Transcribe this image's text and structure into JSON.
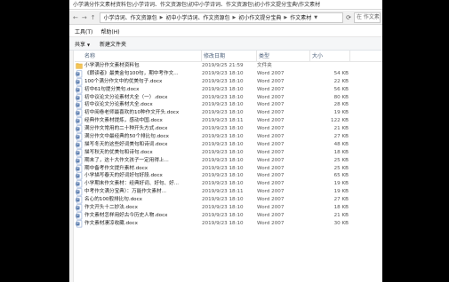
{
  "window": {
    "title": "小学满分作文素材资料包\\小学诗词、作文资源包\\初中小学诗词、作文资源包\\初小作文提分宝典\\作文素材"
  },
  "address": {
    "crumbs": [
      "小学诗词、作文资源包",
      "初中小学诗词、作文资源包",
      "初小作文提分宝典",
      "作文素材"
    ],
    "search_placeholder": "在 作文素材"
  },
  "menu": {
    "items": [
      "工具(T)",
      "帮助(H)"
    ]
  },
  "toolbar": {
    "share_label": "共享",
    "new_folder_label": "新建文件夹"
  },
  "columns": {
    "name": "名称",
    "date": "修改日期",
    "type": "类型",
    "size": "大小"
  },
  "files": [
    {
      "name": "小学满分作文素材资料包",
      "date": "2019/9/25 21:59",
      "type": "文件夹",
      "size": "",
      "kind": "folder"
    },
    {
      "name": "《朗读者》最美金句100句，期中考作文...",
      "date": "2019/9/23 18:10",
      "type": "Word 2007",
      "size": "54 KB",
      "kind": "doc"
    },
    {
      "name": "100个满分作文中的优美句子.docx",
      "date": "2019/9/23 18:10",
      "type": "Word 2007",
      "size": "22 KB",
      "kind": "doc"
    },
    {
      "name": "初中61句提分美句.docx",
      "date": "2019/9/23 18:10",
      "type": "Word 2007",
      "size": "56 KB",
      "kind": "doc"
    },
    {
      "name": "初中议论文分论素材大全（一）.docx",
      "date": "2019/9/23 18:10",
      "type": "Word 2007",
      "size": "80 KB",
      "kind": "doc"
    },
    {
      "name": "初中议论文分论素材大全.docx",
      "date": "2019/9/23 18:10",
      "type": "Word 2007",
      "size": "28 KB",
      "kind": "doc"
    },
    {
      "name": "初中阅卷老师最喜欢的10种作文开头.docx",
      "date": "2019/9/23 18:10",
      "type": "Word 2007",
      "size": "19 KB",
      "kind": "doc"
    },
    {
      "name": "经典作文素材提炼，感动中国.docx",
      "date": "2019/9/23 18:11",
      "type": "Word 2007",
      "size": "122 KB",
      "kind": "doc"
    },
    {
      "name": "满分作文常用的二十种开头方式.docx",
      "date": "2019/9/23 18:10",
      "type": "Word 2007",
      "size": "21 KB",
      "kind": "doc"
    },
    {
      "name": "满分作文中最经典的50个排比句.docx",
      "date": "2019/9/23 18:10",
      "type": "Word 2007",
      "size": "27 KB",
      "kind": "doc"
    },
    {
      "name": "描写冬天的这些好词美句和诗词.docx",
      "date": "2019/9/23 18:10",
      "type": "Word 2007",
      "size": "48 KB",
      "kind": "doc"
    },
    {
      "name": "描写秋天的优美句和诗句.docx",
      "date": "2019/9/23 18:10",
      "type": "Word 2007",
      "size": "18 KB",
      "kind": "doc"
    },
    {
      "name": "期末了，这十大作文孩子一定用得上...",
      "date": "2019/9/23 18:10",
      "type": "Word 2007",
      "size": "25 KB",
      "kind": "doc"
    },
    {
      "name": "期中备考作文提升素材.docx",
      "date": "2019/9/23 18:10",
      "type": "Word 2007",
      "size": "25 KB",
      "kind": "doc"
    },
    {
      "name": "小学描写春天的好词好句好段.docx",
      "date": "2019/9/23 18:10",
      "type": "Word 2007",
      "size": "65 KB",
      "kind": "doc"
    },
    {
      "name": "小学期末作文素材：经典好词、好句、好...",
      "date": "2019/9/23 18:10",
      "type": "Word 2007",
      "size": "19 KB",
      "kind": "doc"
    },
    {
      "name": "中考作文满分宝典）：万能作文素材...",
      "date": "2019/9/23 18:11",
      "type": "Word 2007",
      "size": "19 KB",
      "kind": "doc"
    },
    {
      "name": "名心的100般排比句.docx",
      "date": "2019/9/23 18:10",
      "type": "Word 2007",
      "size": "27 KB",
      "kind": "doc"
    },
    {
      "name": "作文开头十二妙法.docx",
      "date": "2019/9/23 18:10",
      "type": "Word 2007",
      "size": "18 KB",
      "kind": "doc"
    },
    {
      "name": "作文素材怎样用好古今历史人物.docx",
      "date": "2019/9/23 18:10",
      "type": "Word 2007",
      "size": "21 KB",
      "kind": "doc"
    },
    {
      "name": "作文素材凄凉收藏.docx",
      "date": "2019/9/23 18:10",
      "type": "Word 2007",
      "size": "30 KB",
      "kind": "doc"
    }
  ]
}
